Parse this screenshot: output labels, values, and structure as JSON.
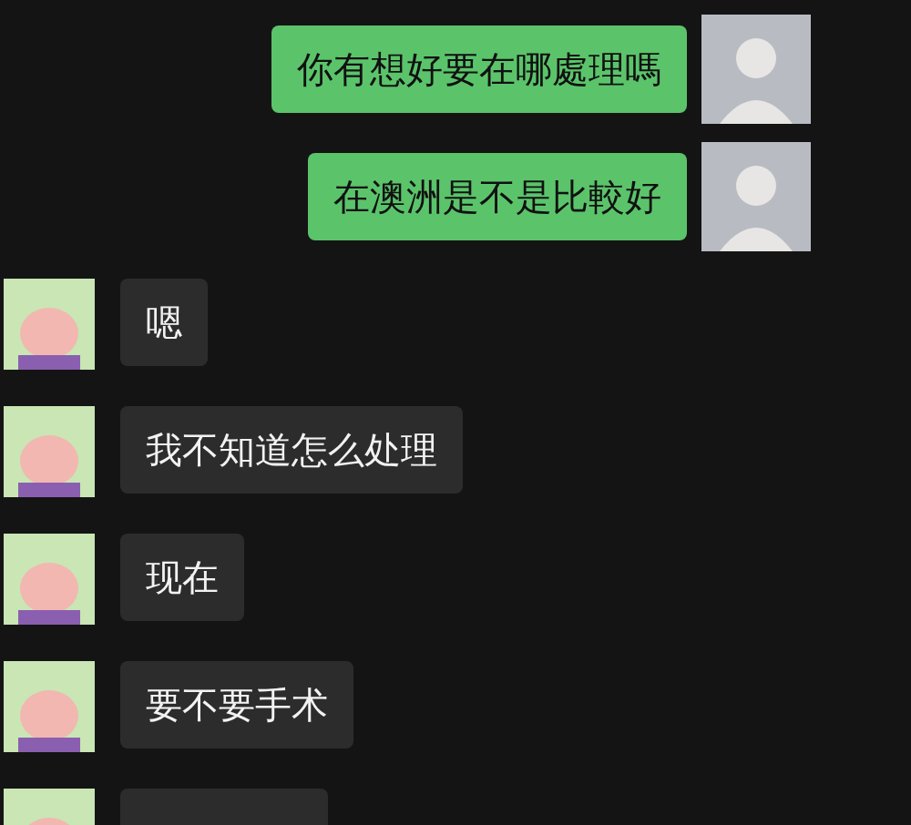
{
  "messages": [
    {
      "kind": "sent",
      "text": "你有想好要在哪處理嗎"
    },
    {
      "kind": "sent",
      "text": "在澳洲是不是比較好"
    },
    {
      "kind": "received",
      "text": "嗯"
    },
    {
      "kind": "received",
      "text": "我不知道怎么处理"
    },
    {
      "kind": "received",
      "text": "现在"
    },
    {
      "kind": "received",
      "text": "要不要手术"
    },
    {
      "kind": "received_cut"
    }
  ]
}
